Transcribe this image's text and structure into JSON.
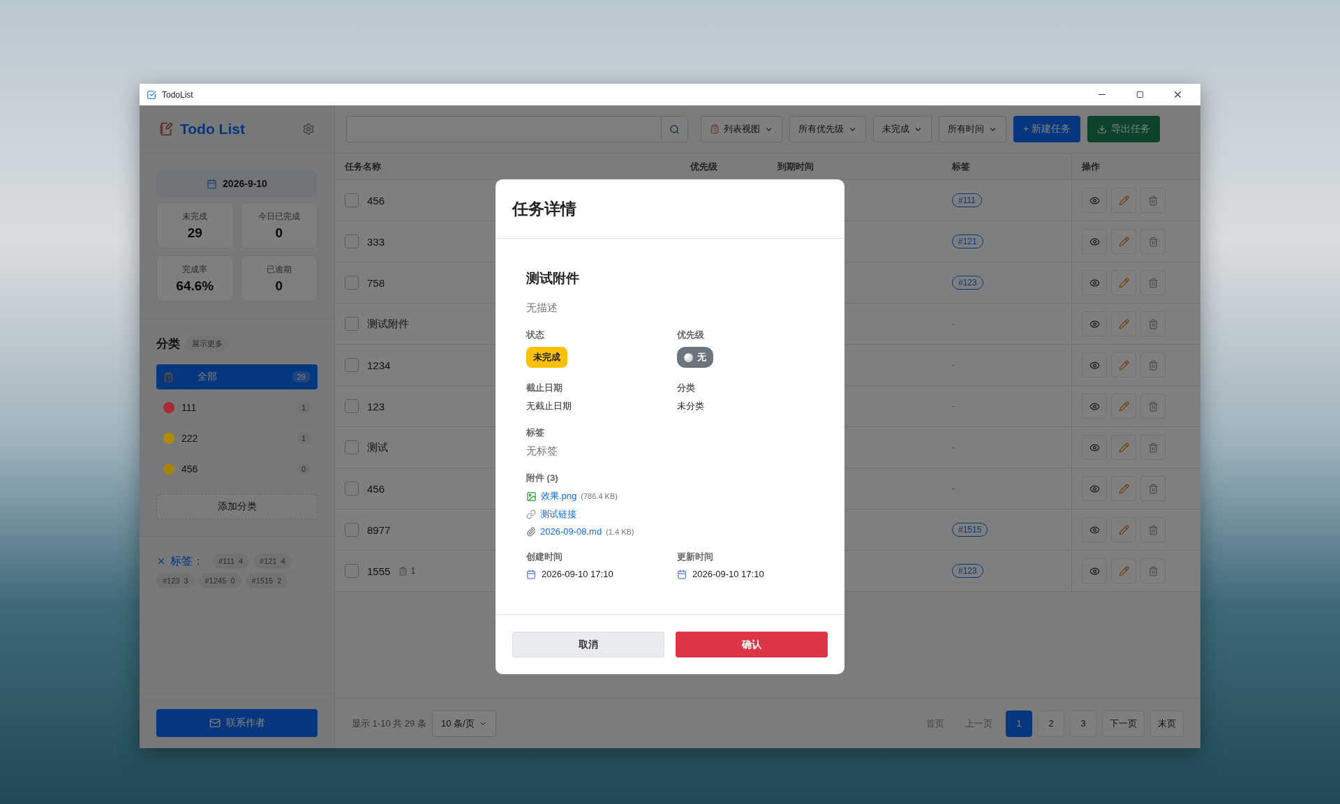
{
  "window": {
    "title": "TodoList"
  },
  "sidebar": {
    "brand": "Todo List",
    "date": "2026-9-10",
    "stats": [
      {
        "label": "未完成",
        "value": "29"
      },
      {
        "label": "今日已完成",
        "value": "0"
      },
      {
        "label": "完成率",
        "value": "64.6%"
      },
      {
        "label": "已逾期",
        "value": "0"
      }
    ],
    "categories": {
      "title": "分类",
      "more": "展示更多",
      "items": [
        {
          "name": "全部",
          "count": "29",
          "selected": true,
          "kind": "all"
        },
        {
          "name": "111",
          "count": "1",
          "selected": false,
          "kind": "color",
          "color": "#a82a35"
        },
        {
          "name": "222",
          "count": "1",
          "selected": false,
          "kind": "color",
          "color": "#b08a0a"
        },
        {
          "name": "456",
          "count": "0",
          "selected": false,
          "kind": "color",
          "color": "#a88508"
        }
      ]
    },
    "add_category": "添加分类",
    "tags": {
      "title": "标签：",
      "items": [
        {
          "name": "#111",
          "count": "4"
        },
        {
          "name": "#121",
          "count": "4"
        },
        {
          "name": "#123",
          "count": "3"
        },
        {
          "name": "#1245",
          "count": "0"
        },
        {
          "name": "#1515",
          "count": "2"
        }
      ]
    },
    "contact": "联系作者"
  },
  "toolbar": {
    "filters": [
      {
        "label": "列表视图",
        "kind": "view"
      },
      {
        "label": "所有优先级",
        "kind": "filter"
      },
      {
        "label": "未完成",
        "kind": "filter"
      },
      {
        "label": "所有时间",
        "kind": "filter"
      }
    ],
    "buttons": [
      {
        "label": "+ 新建任务",
        "kind": "primary"
      },
      {
        "label": "导出任务",
        "kind": "export"
      }
    ]
  },
  "table": {
    "columns": [
      "任务名称",
      "优先级",
      "到期时间",
      "标签",
      "操作"
    ],
    "rows": [
      {
        "name": "456",
        "checked": false,
        "tag": {
          "text": "#111",
          "kind": "pill"
        }
      },
      {
        "name": "333",
        "checked": false,
        "tag": {
          "text": "#121",
          "kind": "pill"
        }
      },
      {
        "name": "758",
        "checked": false,
        "tag": {
          "text": "#123",
          "kind": "pill"
        }
      },
      {
        "name": "测试附件",
        "checked": false,
        "tag": {
          "text": "-",
          "kind": "dash"
        }
      },
      {
        "name": "1234",
        "checked": false,
        "tag": {
          "text": "-",
          "kind": "dash"
        }
      },
      {
        "name": "123",
        "checked": false,
        "tag": {
          "text": "-",
          "kind": "dash"
        }
      },
      {
        "name": "测试",
        "checked": false,
        "tag": {
          "text": "-",
          "kind": "dash"
        }
      },
      {
        "name": "456",
        "checked": false,
        "tag": {
          "text": "-",
          "kind": "dash"
        }
      },
      {
        "name": "8977",
        "checked": false,
        "tag": {
          "text": "#1515",
          "kind": "pill"
        }
      },
      {
        "name": "1555",
        "checked": false,
        "attachments": "1",
        "tag": {
          "text": "#123",
          "kind": "pill"
        }
      }
    ]
  },
  "pagination": {
    "summary": "显示 1-10 共 29 条",
    "page_size": "10 条/页",
    "items": [
      {
        "label": "首页",
        "selected": false,
        "disabled": true
      },
      {
        "label": "上一页",
        "selected": false,
        "disabled": true
      },
      {
        "label": "1",
        "selected": true,
        "disabled": false
      },
      {
        "label": "2",
        "selected": false,
        "disabled": false
      },
      {
        "label": "3",
        "selected": false,
        "disabled": false
      },
      {
        "label": "下一页",
        "selected": false,
        "disabled": false
      },
      {
        "label": "末页",
        "selected": false,
        "disabled": false
      }
    ]
  },
  "modal": {
    "title": "任务详情",
    "task_title": "测试附件",
    "description": "无描述",
    "status": {
      "label": "状态",
      "value": "未完成",
      "done": false
    },
    "priority": {
      "label": "优先级",
      "value": "无",
      "kind": "none"
    },
    "due": {
      "label": "截止日期",
      "value": "无截止日期"
    },
    "category": {
      "label": "分类",
      "value": "未分类"
    },
    "tags": {
      "label": "标签",
      "value": "无标签"
    },
    "attachments": {
      "label": "附件 (3)",
      "items": [
        {
          "kind": "image",
          "name": "效果.png",
          "size": "(786.4 KB)"
        },
        {
          "kind": "link",
          "name": "测试链接"
        },
        {
          "kind": "file",
          "name": "2026-09-08.md",
          "size": "(1.4 KB)"
        }
      ]
    },
    "created": {
      "label": "创建时间",
      "value": "2026-09-10 17:10"
    },
    "updated": {
      "label": "更新时间",
      "value": "2026-09-10 17:10"
    },
    "cancel": "取消",
    "confirm": "确认"
  }
}
